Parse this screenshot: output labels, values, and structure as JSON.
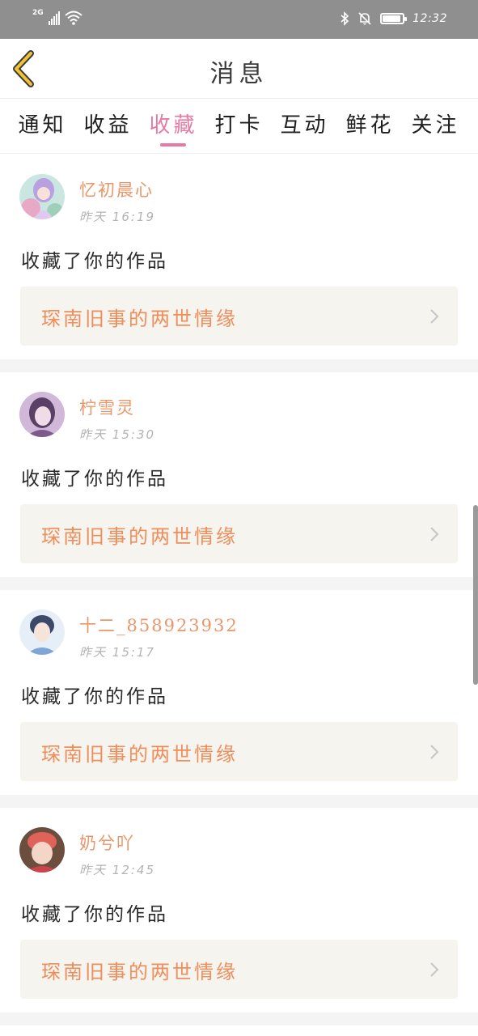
{
  "status_bar": {
    "network_label": "2G",
    "time": "12:32",
    "icons": [
      "signal-icon",
      "wifi-icon",
      "bluetooth-icon",
      "mute-bell-icon",
      "battery-icon"
    ]
  },
  "header": {
    "title": "消息",
    "back_icon": "chevron-left-icon",
    "accent_color": "#f1c232"
  },
  "tabs": [
    {
      "label": "通知",
      "active": false
    },
    {
      "label": "收益",
      "active": false
    },
    {
      "label": "收藏",
      "active": true
    },
    {
      "label": "打卡",
      "active": false
    },
    {
      "label": "互动",
      "active": false
    },
    {
      "label": "鲜花",
      "active": false
    },
    {
      "label": "关注",
      "active": false
    }
  ],
  "colors": {
    "active_tab": "#e77aa4",
    "username": "#e8976a",
    "work_title": "#ee8e5c",
    "card_link_bg": "#f5f4ee"
  },
  "feed": [
    {
      "user": "忆初晨心",
      "day": "昨天",
      "time": "16:19",
      "action": "收藏了你的作品",
      "work": "琛南旧事的两世情缘"
    },
    {
      "user": "柠雪灵",
      "day": "昨天",
      "time": "15:30",
      "action": "收藏了你的作品",
      "work": "琛南旧事的两世情缘"
    },
    {
      "user": "十二_858923932",
      "day": "昨天",
      "time": "15:17",
      "action": "收藏了你的作品",
      "work": "琛南旧事的两世情缘"
    },
    {
      "user": "奶兮吖",
      "day": "昨天",
      "time": "12:45",
      "action": "收藏了你的作品",
      "work": "琛南旧事的两世情缘"
    }
  ]
}
